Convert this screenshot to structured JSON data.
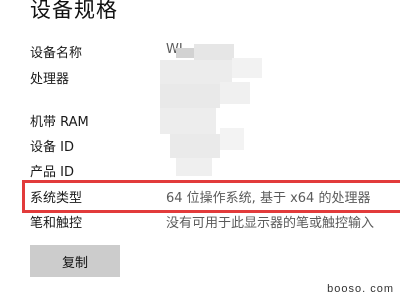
{
  "page": {
    "title": "设备规格"
  },
  "specs": [
    {
      "label": "设备名称",
      "value": "WI"
    },
    {
      "label": "处理器",
      "value": ""
    },
    {
      "label": "机带 RAM",
      "value": ""
    },
    {
      "label": "设备 ID",
      "value": ""
    },
    {
      "label": "产品 ID",
      "value": ""
    },
    {
      "label": "系统类型",
      "value": "64 位操作系统, 基于 x64 的处理器"
    },
    {
      "label": "笔和触控",
      "value": "没有可用于此显示器的笔或触控输入"
    }
  ],
  "copy_button": {
    "label": "复制"
  },
  "watermark": {
    "text": "booso. com"
  },
  "colors": {
    "highlight": "#e23b3b",
    "button_bg": "#cccccc",
    "blur_tile": "#ebebeb"
  }
}
